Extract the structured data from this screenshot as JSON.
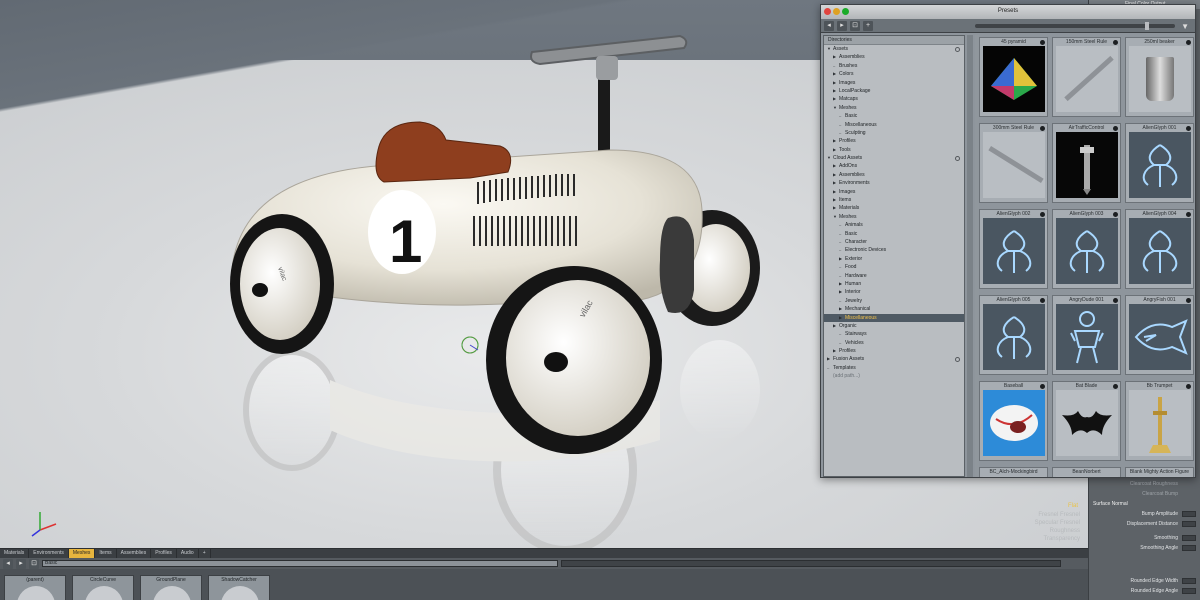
{
  "viewport": {
    "car_number": "1",
    "brand": "vilac",
    "corner_label": "Flat",
    "faint_lines": [
      "Fresnel Fresnel",
      "Specular Fresnel",
      "Roughness",
      "Transparency"
    ]
  },
  "presets": {
    "title": "Presets",
    "toolbar": [
      "◂",
      "▸",
      "⊡",
      "+"
    ],
    "directories_header": "Directories",
    "tree": [
      {
        "label": "Assets",
        "depth": 0,
        "arrow": "▼",
        "dot": true
      },
      {
        "label": "Assemblies",
        "depth": 1,
        "arrow": "▶"
      },
      {
        "label": "Brushes",
        "depth": 1,
        "arrow": "–"
      },
      {
        "label": "Colors",
        "depth": 1,
        "arrow": "▶"
      },
      {
        "label": "Images",
        "depth": 1,
        "arrow": "▶"
      },
      {
        "label": "LocalPackage",
        "depth": 1,
        "arrow": "▶"
      },
      {
        "label": "Matcaps",
        "depth": 1,
        "arrow": "▶"
      },
      {
        "label": "Meshes",
        "depth": 1,
        "arrow": "▼"
      },
      {
        "label": "Basic",
        "depth": 2,
        "arrow": "–"
      },
      {
        "label": "Miscellaneous",
        "depth": 2,
        "arrow": "–"
      },
      {
        "label": "Sculpting",
        "depth": 2,
        "arrow": "–"
      },
      {
        "label": "Profiles",
        "depth": 1,
        "arrow": "▶"
      },
      {
        "label": "Tools",
        "depth": 1,
        "arrow": "▶"
      },
      {
        "label": "Cloud Assets",
        "depth": 0,
        "arrow": "▼",
        "dot": true
      },
      {
        "label": "AddOns",
        "depth": 1,
        "arrow": "▶"
      },
      {
        "label": "Assemblies",
        "depth": 1,
        "arrow": "▶"
      },
      {
        "label": "Environments",
        "depth": 1,
        "arrow": "▶"
      },
      {
        "label": "Images",
        "depth": 1,
        "arrow": "▶"
      },
      {
        "label": "Items",
        "depth": 1,
        "arrow": "▶"
      },
      {
        "label": "Materials",
        "depth": 1,
        "arrow": "▶"
      },
      {
        "label": "Meshes",
        "depth": 1,
        "arrow": "▼"
      },
      {
        "label": "Animals",
        "depth": 2,
        "arrow": "–"
      },
      {
        "label": "Basic",
        "depth": 2,
        "arrow": "–"
      },
      {
        "label": "Character",
        "depth": 2,
        "arrow": "–"
      },
      {
        "label": "Electronic Devices",
        "depth": 2,
        "arrow": "–"
      },
      {
        "label": "Exterior",
        "depth": 2,
        "arrow": "▶"
      },
      {
        "label": "Food",
        "depth": 2,
        "arrow": "–"
      },
      {
        "label": "Hardware",
        "depth": 2,
        "arrow": "–"
      },
      {
        "label": "Human",
        "depth": 2,
        "arrow": "▶"
      },
      {
        "label": "Interior",
        "depth": 2,
        "arrow": "▶"
      },
      {
        "label": "Jewelry",
        "depth": 2,
        "arrow": "–"
      },
      {
        "label": "Mechanical",
        "depth": 2,
        "arrow": "▶"
      },
      {
        "label": "Miscellaneous",
        "depth": 2,
        "arrow": "▶",
        "selected": true
      },
      {
        "label": "Organic",
        "depth": 1,
        "arrow": "▶"
      },
      {
        "label": "Stairways",
        "depth": 2,
        "arrow": "–"
      },
      {
        "label": "Vehicles",
        "depth": 2,
        "arrow": "–"
      },
      {
        "label": "Profiles",
        "depth": 1,
        "arrow": "▶"
      },
      {
        "label": "Fusion Assets",
        "depth": 0,
        "arrow": "▶",
        "dot": true
      },
      {
        "label": "Templates",
        "depth": 0,
        "arrow": "–"
      },
      {
        "label": "(add path...)",
        "depth": 0,
        "arrow": "",
        "muted": true
      }
    ],
    "tiles": [
      {
        "name": "45 pyramid",
        "thumb": "pyramid"
      },
      {
        "name": "150mm Steel Rule",
        "thumb": "rule"
      },
      {
        "name": "250ml beaker",
        "thumb": "beaker"
      },
      {
        "name": "300mm Steel Rule",
        "thumb": "rule2"
      },
      {
        "name": "AirTrafficControl",
        "thumb": "tower"
      },
      {
        "name": "AlienGlyph 001",
        "thumb": "glyph1"
      },
      {
        "name": "AlienGlyph 002",
        "thumb": "glyph2"
      },
      {
        "name": "AlienGlyph 003",
        "thumb": "glyph3"
      },
      {
        "name": "AlienGlyph 004",
        "thumb": "glyph4"
      },
      {
        "name": "AlienGlyph 005",
        "thumb": "glyph5"
      },
      {
        "name": "AngryDude 001",
        "thumb": "dude"
      },
      {
        "name": "AngryFish 001",
        "thumb": "fish"
      },
      {
        "name": "Baseball",
        "thumb": "baseball"
      },
      {
        "name": "Bat Blade",
        "thumb": "bat"
      },
      {
        "name": "Bb Trumpet",
        "thumb": "trumpet"
      },
      {
        "name": "BC_Alch-Mockingbird",
        "thumb": "blank"
      },
      {
        "name": "BeanNorbert",
        "thumb": "blank"
      },
      {
        "name": "Blank Mighty Action Figure",
        "thumb": "blank"
      }
    ]
  },
  "properties": {
    "top_label": "Final Color Output",
    "faint_rows": [
      "Clearcoat Roughness",
      "Clearcoat Bump"
    ],
    "section": "Surface Normal",
    "rows": [
      "Bump Amplitude",
      "Displacement Distance",
      "Smoothing",
      "Smoothing Angle",
      "Rounded Edge Width",
      "Rounded Edge Angle"
    ]
  },
  "bottom": {
    "tabs": [
      "Materials",
      "Environments",
      "Meshes",
      "Items",
      "Assemblies",
      "Profiles",
      "Audio",
      "+"
    ],
    "active_tab": "Meshes",
    "search_value": "Basic",
    "items": [
      "(parent)",
      "CircleCurve",
      "GroundPlane",
      "ShadowCatcher"
    ]
  },
  "colors": {
    "accent": "#e7b53e",
    "selection_text": "#f2c24b",
    "car_body": "#ece8dc",
    "seat": "#8e3e1e"
  }
}
